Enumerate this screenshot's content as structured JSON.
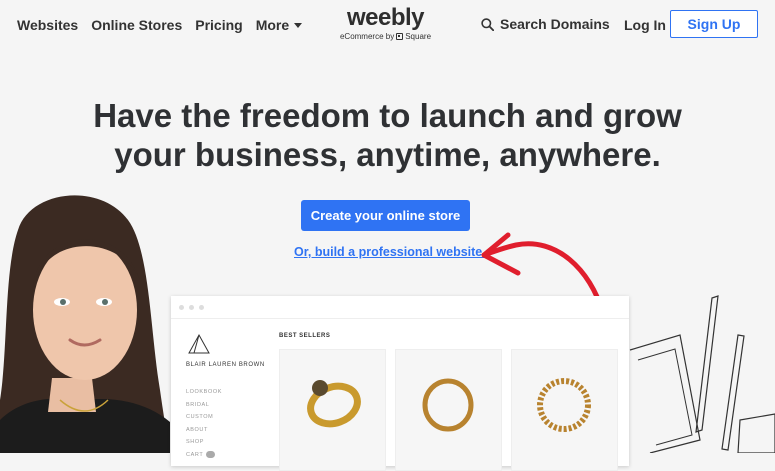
{
  "nav": {
    "links": [
      "Websites",
      "Online Stores",
      "Pricing",
      "More"
    ],
    "logo": {
      "word": "weebly",
      "sub_prefix": "eCommerce by",
      "sub_brand": "Square"
    },
    "search_label": "Search Domains",
    "login_label": "Log In",
    "signup_label": "Sign Up"
  },
  "hero": {
    "title_line1": "Have the freedom to launch and grow",
    "title_line2": "your business, anytime, anywhere.",
    "cta_label": "Create your online store",
    "alt_link": "Or, build a professional website ›"
  },
  "mockup": {
    "brand": "BLAIR LAUREN BROWN",
    "menu": [
      "LOOKBOOK",
      "BRIDAL",
      "CUSTOM",
      "ABOUT",
      "SHOP",
      "CART"
    ],
    "section_title": "BEST SELLERS"
  },
  "colors": {
    "accent": "#2f73f3",
    "arrow": "#e01e2d",
    "background": "#f5f5f5"
  },
  "icons": [
    "search-icon",
    "caret-down-icon",
    "square-logo-icon",
    "red-arrow-icon"
  ]
}
